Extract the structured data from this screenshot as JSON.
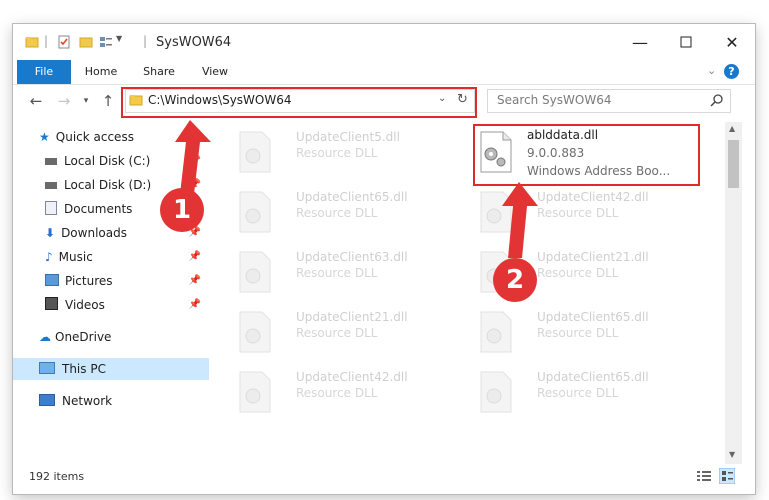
{
  "window": {
    "title": "SysWOW64"
  },
  "ribbon": {
    "tabs": [
      "File",
      "Home",
      "Share",
      "View"
    ]
  },
  "address": {
    "path": "C:\\Windows\\SysWOW64"
  },
  "search": {
    "placeholder": "Search SysWOW64"
  },
  "sidebar": {
    "items": [
      {
        "label": "Quick access",
        "icon": "star-icon"
      },
      {
        "label": "Local Disk (C:)",
        "icon": "drive-icon",
        "pinned": true
      },
      {
        "label": "Local Disk (D:)",
        "icon": "drive-icon",
        "pinned": true
      },
      {
        "label": "Documents",
        "icon": "documents-icon",
        "pinned": true
      },
      {
        "label": "Downloads",
        "icon": "downloads-icon",
        "pinned": true
      },
      {
        "label": "Music",
        "icon": "music-icon",
        "pinned": true
      },
      {
        "label": "Pictures",
        "icon": "pictures-icon",
        "pinned": true
      },
      {
        "label": "Videos",
        "icon": "videos-icon",
        "pinned": true
      },
      {
        "label": "OneDrive",
        "icon": "cloud-icon"
      },
      {
        "label": "This PC",
        "icon": "computer-icon",
        "selected": true
      },
      {
        "label": "Network",
        "icon": "network-icon"
      }
    ]
  },
  "files": {
    "col1": [
      {
        "name": "UpdateClient5.dll",
        "type": "Resource DLL"
      },
      {
        "name": "UpdateClient65.dll",
        "type": "Resource DLL"
      },
      {
        "name": "UpdateClient63.dll",
        "type": "Resource DLL"
      },
      {
        "name": "UpdateClient21.dll",
        "type": "Resource DLL"
      },
      {
        "name": "UpdateClient42.dll",
        "type": "Resource DLL"
      }
    ],
    "highlighted": {
      "name": "ablddata.dll",
      "version": "9.0.0.883",
      "description": "Windows Address Boo..."
    },
    "col2": [
      {
        "name": "UpdateClient42.dll",
        "type": "Resource DLL"
      },
      {
        "name": "UpdateClient21.dll",
        "type": "Resource DLL"
      },
      {
        "name": "UpdateClient65.dll",
        "type": "Resource DLL"
      },
      {
        "name": "UpdateClient65.dll",
        "type": "Resource DLL"
      }
    ]
  },
  "status": {
    "item_count": "192 items"
  },
  "annotations": {
    "step1": "1",
    "step2": "2",
    "color": "#e02b2b"
  }
}
